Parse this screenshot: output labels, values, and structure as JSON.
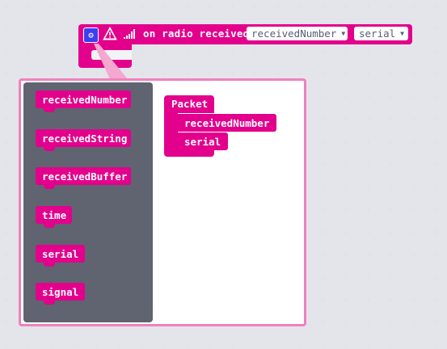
{
  "event_block": {
    "label": "on radio received",
    "dropdown_1": "receivedNumber",
    "dropdown_2": "serial"
  },
  "flyout": {
    "items": [
      {
        "label": "receivedNumber"
      },
      {
        "label": "receivedString"
      },
      {
        "label": "receivedBuffer"
      },
      {
        "label": "time"
      },
      {
        "label": "serial"
      },
      {
        "label": "signal"
      }
    ]
  },
  "packet": {
    "title": "Packet",
    "items": [
      {
        "label": "receivedNumber"
      },
      {
        "label": "serial"
      }
    ]
  },
  "colors": {
    "block": "#e3008c",
    "flyout_bg": "#5f6470",
    "mutator_border": "#f27fbf",
    "gear_button": "#3b3ff2",
    "workspace_bg": "#f2f3f5"
  },
  "icons": [
    "gear-icon",
    "warning-icon",
    "signal-strength-icon",
    "chevron-down-icon"
  ]
}
